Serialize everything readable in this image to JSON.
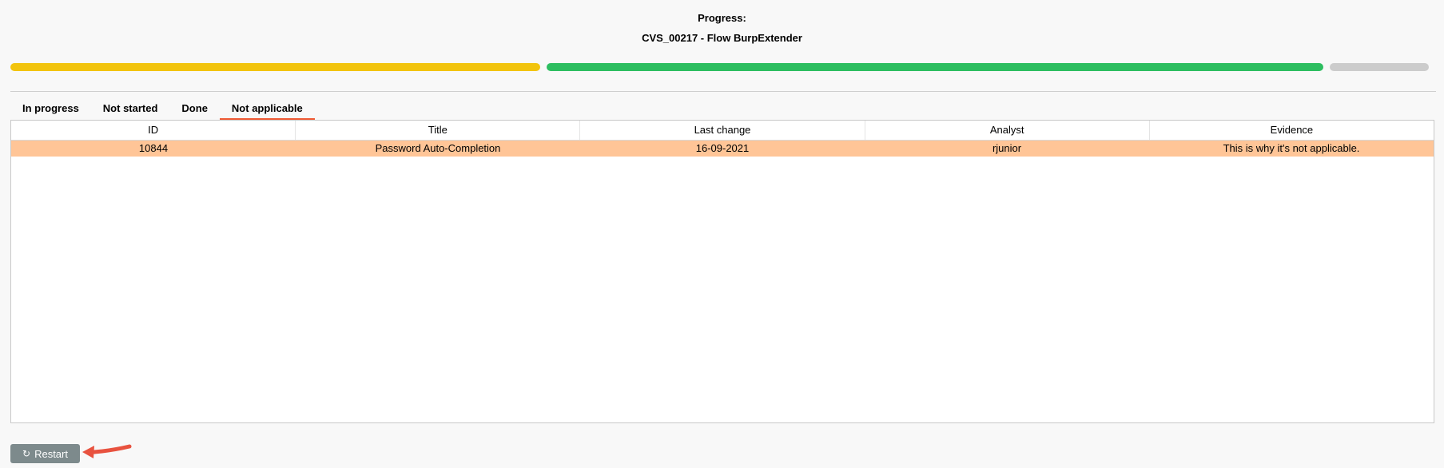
{
  "header": {
    "label": "Progress:",
    "subtitle": "CVS_00217 - Flow BurpExtender"
  },
  "progress": {
    "segments": [
      {
        "name": "in-progress",
        "fraction": 0.375,
        "color": "#f2c40d"
      },
      {
        "name": "done",
        "fraction": 0.55,
        "color": "#2dbe60"
      },
      {
        "name": "not-started",
        "fraction": 0.07,
        "color": "#cccccc"
      }
    ]
  },
  "tabs": [
    {
      "label": "In progress",
      "active": false
    },
    {
      "label": "Not started",
      "active": false
    },
    {
      "label": "Done",
      "active": false
    },
    {
      "label": "Not applicable",
      "active": true
    }
  ],
  "table": {
    "columns": [
      "ID",
      "Title",
      "Last change",
      "Analyst",
      "Evidence"
    ],
    "rows": [
      {
        "id": "10844",
        "title": "Password Auto-Completion",
        "last_change": "16-09-2021",
        "analyst": "rjunior",
        "evidence": "This is why it's not applicable.",
        "selected": true
      }
    ]
  },
  "restart_button": {
    "label": "Restart",
    "icon": "refresh-icon"
  },
  "colors": {
    "tab_underline": "#ef5a34",
    "selected_row": "#ffc597",
    "button_bg": "#7d8a8c",
    "arrow": "#e8523f"
  }
}
